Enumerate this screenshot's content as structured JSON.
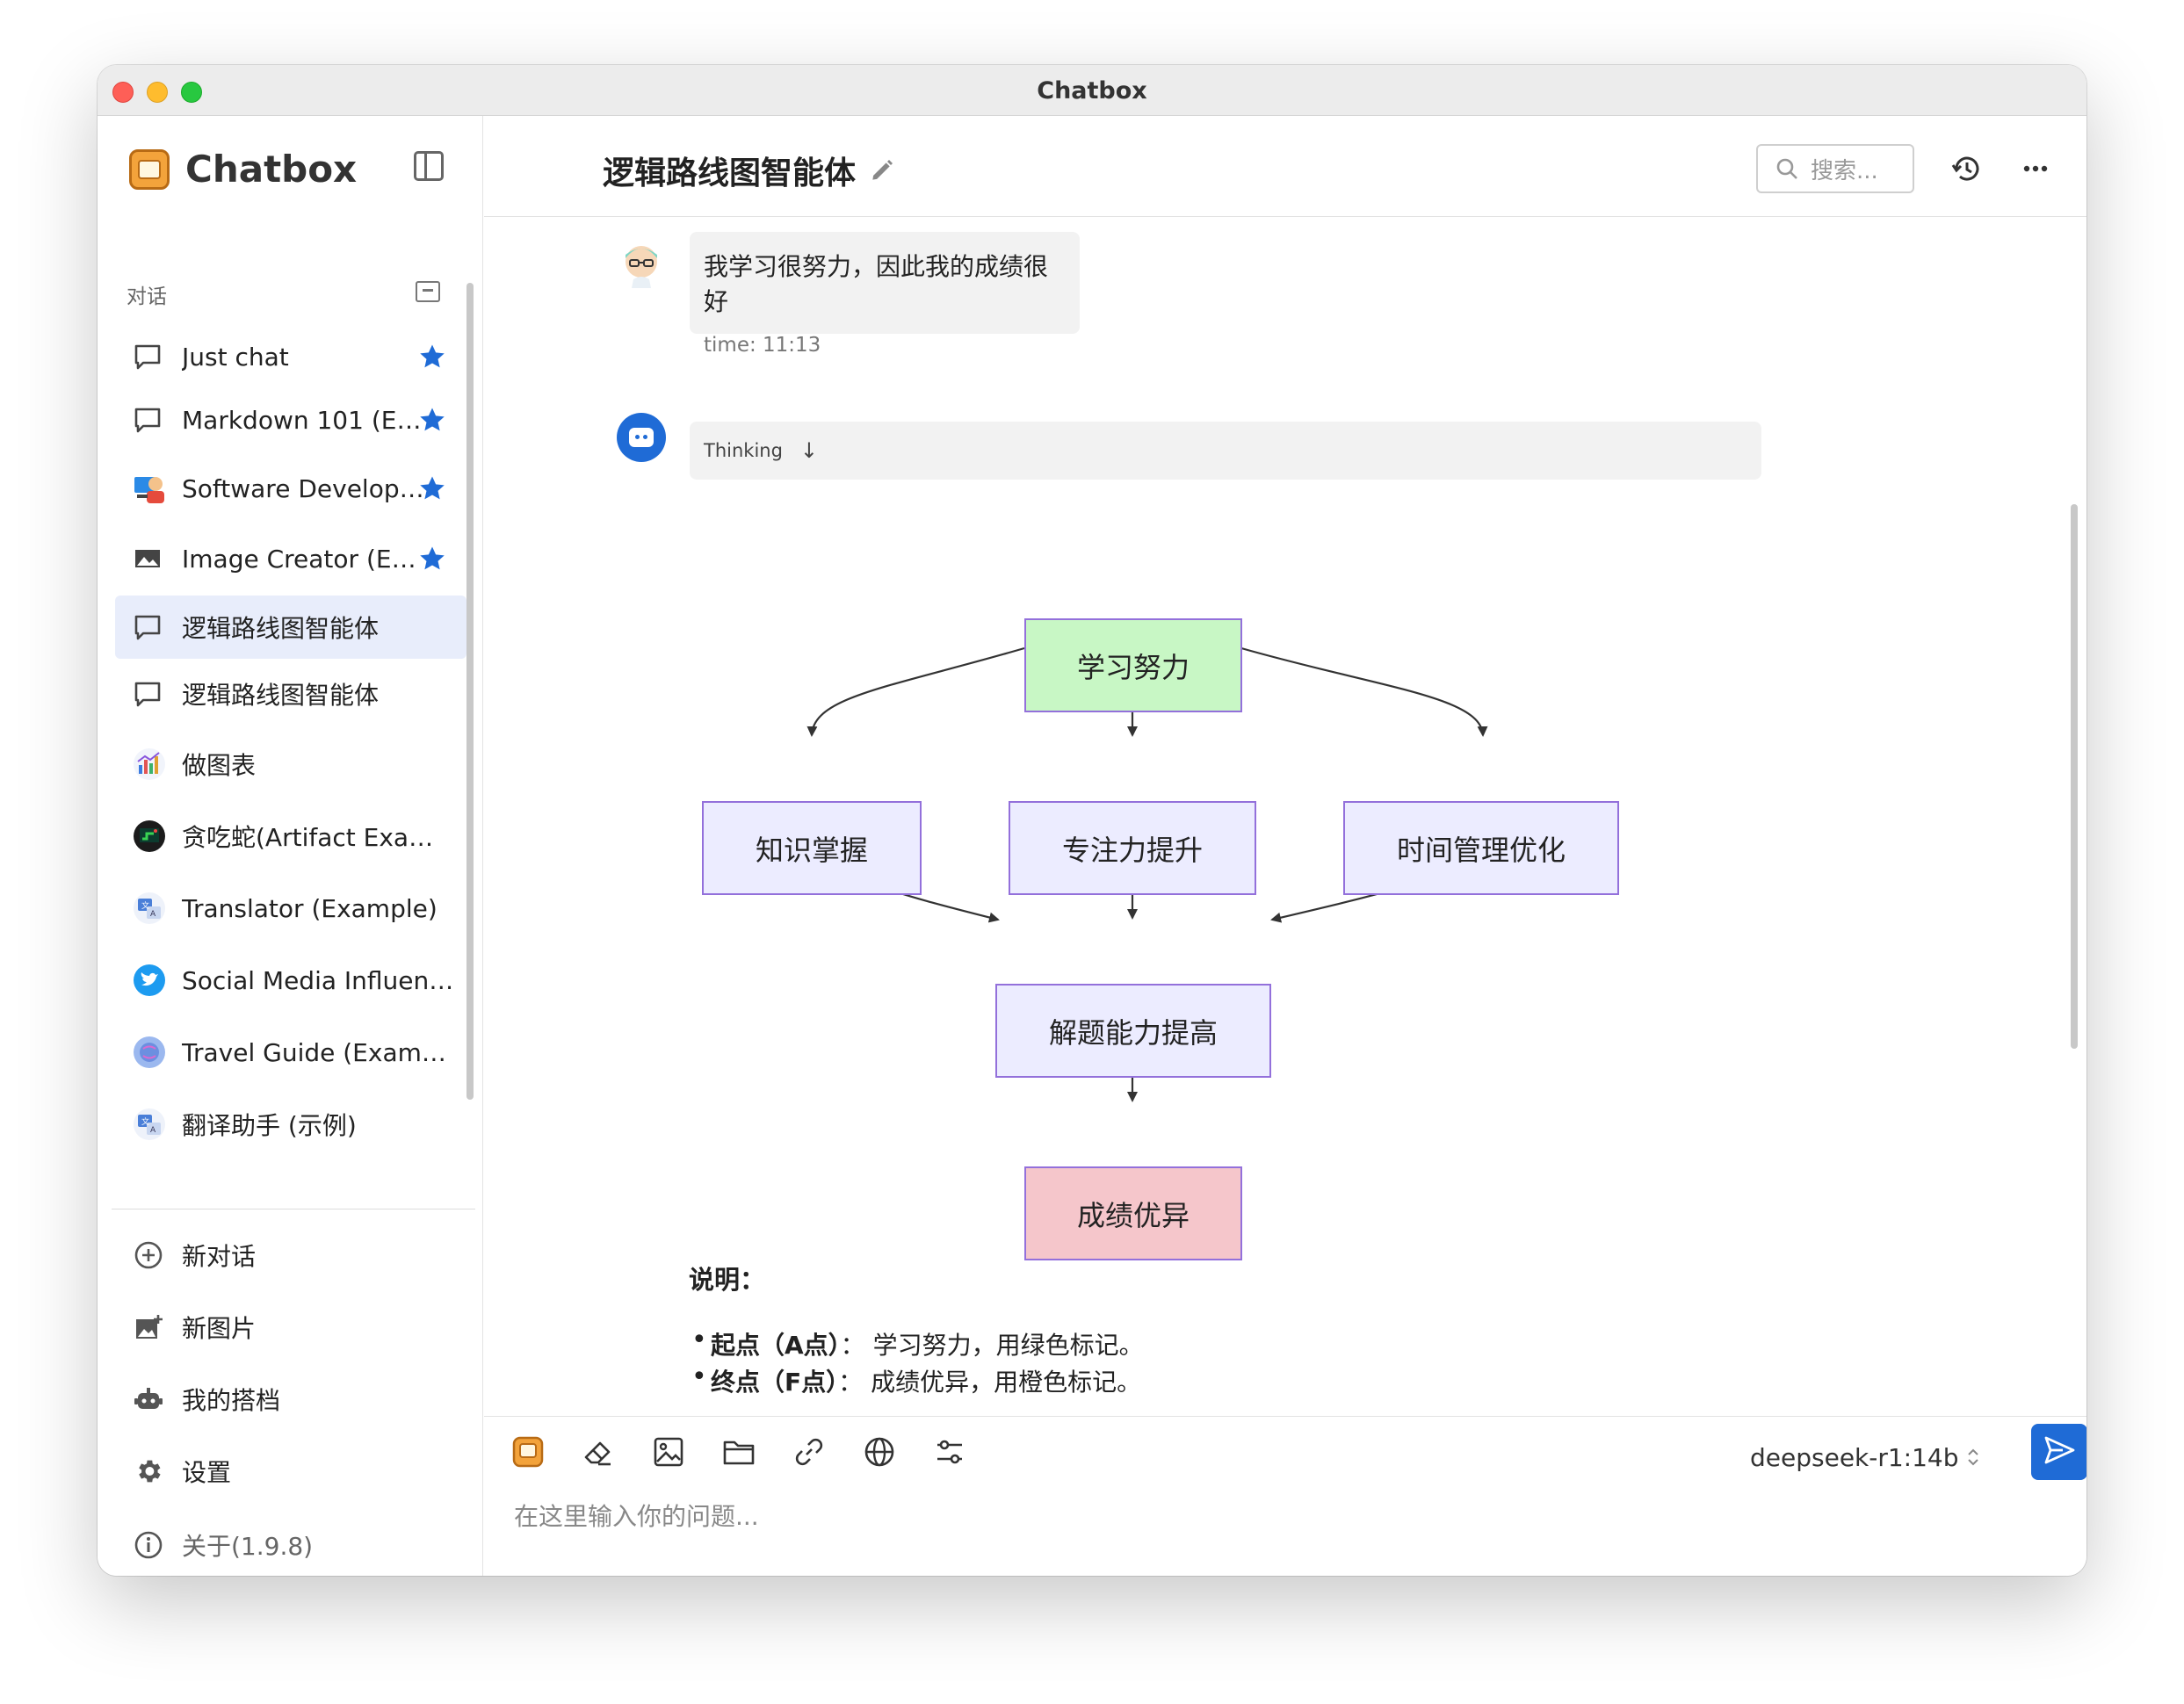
{
  "window": {
    "title": "Chatbox"
  },
  "sidebar": {
    "brand": "Chatbox",
    "section_label": "对话",
    "conversations": [
      {
        "label": "Just chat",
        "icon": "chat-bubble-icon",
        "starred": true,
        "active": false
      },
      {
        "label": "Markdown 101 (Example)",
        "icon": "chat-bubble-icon",
        "starred": true,
        "active": false
      },
      {
        "label": "Software Developer (Example)",
        "icon": "developer-avatar-icon",
        "starred": true,
        "active": false
      },
      {
        "label": "Image Creator (Example)",
        "icon": "image-icon",
        "starred": true,
        "active": false
      },
      {
        "label": "逻辑路线图智能体",
        "icon": "chat-bubble-icon",
        "starred": false,
        "active": true
      },
      {
        "label": "逻辑路线图智能体",
        "icon": "chat-bubble-icon",
        "starred": false,
        "active": false
      },
      {
        "label": "做图表",
        "icon": "chart-avatar-icon",
        "starred": false,
        "active": false
      },
      {
        "label": "贪吃蛇(Artifact Example)",
        "icon": "snake-game-avatar-icon",
        "starred": false,
        "active": false
      },
      {
        "label": "Translator (Example)",
        "icon": "translator-avatar-icon",
        "starred": false,
        "active": false
      },
      {
        "label": "Social Media Influencer (Example)",
        "icon": "twitter-avatar-icon",
        "starred": false,
        "active": false
      },
      {
        "label": "Travel Guide (Example)",
        "icon": "globe-avatar-icon",
        "starred": false,
        "active": false
      },
      {
        "label": "翻译助手 (示例)",
        "icon": "translator-avatar-icon",
        "starred": false,
        "active": false
      }
    ],
    "bottom_menu": [
      {
        "label": "新对话",
        "icon": "plus-circle-icon"
      },
      {
        "label": "新图片",
        "icon": "new-image-icon"
      },
      {
        "label": "我的搭档",
        "icon": "robot-icon"
      },
      {
        "label": "设置",
        "icon": "gear-icon"
      },
      {
        "label": "关于(1.9.8)",
        "icon": "info-icon"
      }
    ]
  },
  "header": {
    "title": "逻辑路线图智能体",
    "search_placeholder": "搜索..."
  },
  "messages": {
    "user": {
      "text": "我学习很努力，因此我的成绩很好",
      "time": "time: 11:13"
    },
    "assistant": {
      "thinking_label": "Thinking",
      "flowchart": {
        "start": "学习努力",
        "middle": [
          "知识掌握",
          "专注力提升",
          "时间管理优化"
        ],
        "merge": "解题能力提高",
        "end": "成绩优异"
      },
      "explanation_title": "说明：",
      "bullets": [
        {
          "term": "起点（A点）",
          "sep": "：",
          "desc": "学习努力，用绿色标记。"
        },
        {
          "term": "终点（F点）",
          "sep": "：",
          "desc": "成绩优异，用橙色标记。"
        }
      ]
    }
  },
  "composer": {
    "model": "deepseek-r1:14b",
    "placeholder": "在这里输入你的问题..."
  },
  "colors": {
    "accent": "#1f6bd6",
    "active_bg": "#e8edfb",
    "node_start": "#c8f7c5",
    "node_mid": "#ececff",
    "node_end": "#f5c6cb",
    "node_border": "#9370db"
  }
}
